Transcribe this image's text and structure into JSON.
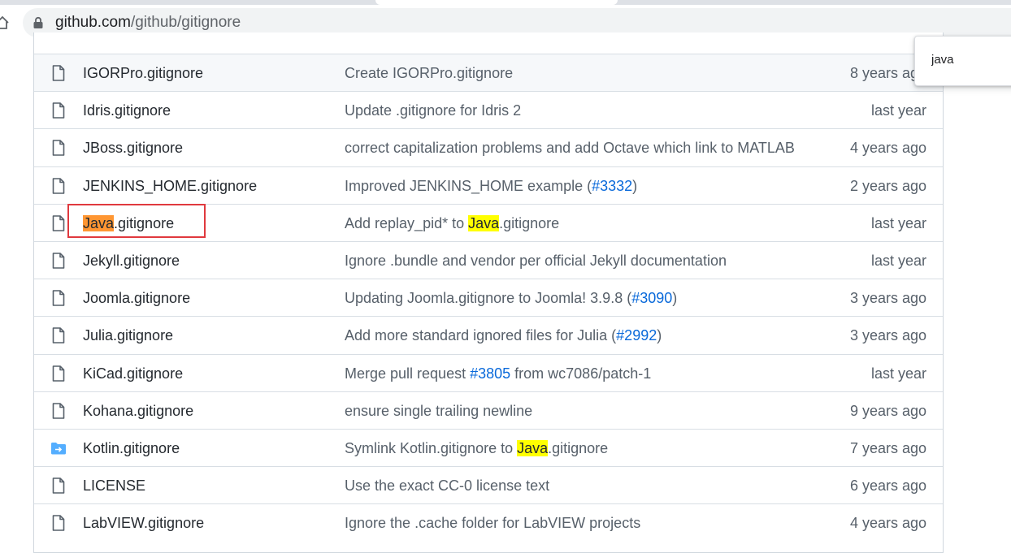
{
  "browser": {
    "url_host": "github.com",
    "url_path": "/github/gitignore"
  },
  "find": {
    "query": "java"
  },
  "files": [
    {
      "icon": "file-icon",
      "name_pre": "",
      "name_hl": "",
      "name_post": "IGORPro.gitignore",
      "msg_pre": "Create IGORPro.gitignore",
      "msg_link": "",
      "msg_hl": "",
      "msg_post": "",
      "age": "8 years ago",
      "hover": true
    },
    {
      "icon": "file-icon",
      "name_pre": "",
      "name_hl": "",
      "name_post": "Idris.gitignore",
      "msg_pre": "Update .gitignore for Idris 2",
      "msg_link": "",
      "msg_hl": "",
      "msg_post": "",
      "age": "last year"
    },
    {
      "icon": "file-icon",
      "name_pre": "",
      "name_hl": "",
      "name_post": "JBoss.gitignore",
      "msg_pre": "correct capitalization problems and add Octave which link to MATLAB",
      "msg_link": "",
      "msg_hl": "",
      "msg_post": "",
      "age": "4 years ago"
    },
    {
      "icon": "file-icon",
      "name_pre": "",
      "name_hl": "",
      "name_post": "JENKINS_HOME.gitignore",
      "msg_pre": "Improved JENKINS_HOME example (",
      "msg_link": "#3332",
      "msg_hl": "",
      "msg_post": ")",
      "age": "2 years ago"
    },
    {
      "icon": "file-icon",
      "name_pre": "",
      "name_hl": "Java",
      "name_hl_active": true,
      "name_post": ".gitignore",
      "msg_pre": "Add replay_pid* to ",
      "msg_link": "",
      "msg_hl": "Java",
      "msg_post": ".gitignore",
      "age": "last year"
    },
    {
      "icon": "file-icon",
      "name_pre": "",
      "name_hl": "",
      "name_post": "Jekyll.gitignore",
      "msg_pre": "Ignore .bundle and vendor per official Jekyll documentation",
      "msg_link": "",
      "msg_hl": "",
      "msg_post": "",
      "age": "last year"
    },
    {
      "icon": "file-icon",
      "name_pre": "",
      "name_hl": "",
      "name_post": "Joomla.gitignore",
      "msg_pre": "Updating Joomla.gitignore to Joomla! 3.9.8 (",
      "msg_link": "#3090",
      "msg_hl": "",
      "msg_post": ")",
      "age": "3 years ago"
    },
    {
      "icon": "file-icon",
      "name_pre": "",
      "name_hl": "",
      "name_post": "Julia.gitignore",
      "msg_pre": "Add more standard ignored files for Julia (",
      "msg_link": "#2992",
      "msg_hl": "",
      "msg_post": ")",
      "age": "3 years ago"
    },
    {
      "icon": "file-icon",
      "name_pre": "",
      "name_hl": "",
      "name_post": "KiCad.gitignore",
      "msg_pre": "Merge pull request ",
      "msg_link": "#3805",
      "msg_hl": "",
      "msg_post": " from wc7086/patch-1",
      "age": "last year"
    },
    {
      "icon": "file-icon",
      "name_pre": "",
      "name_hl": "",
      "name_post": "Kohana.gitignore",
      "msg_pre": "ensure single trailing newline",
      "msg_link": "",
      "msg_hl": "",
      "msg_post": "",
      "age": "9 years ago"
    },
    {
      "icon": "symlink-icon",
      "name_pre": "",
      "name_hl": "",
      "name_post": "Kotlin.gitignore",
      "msg_pre": "Symlink Kotlin.gitignore to ",
      "msg_link": "",
      "msg_hl": "Java",
      "msg_post": ".gitignore",
      "age": "7 years ago"
    },
    {
      "icon": "file-icon",
      "name_pre": "",
      "name_hl": "",
      "name_post": "LICENSE",
      "msg_pre": "Use the exact CC-0 license text",
      "msg_link": "",
      "msg_hl": "",
      "msg_post": "",
      "age": "6 years ago"
    },
    {
      "icon": "file-icon",
      "name_pre": "",
      "name_hl": "",
      "name_post": "LabVIEW.gitignore",
      "msg_pre": "Ignore the .cache folder for LabVIEW projects",
      "msg_link": "",
      "msg_hl": "",
      "msg_post": "",
      "age": "4 years ago"
    }
  ],
  "colors": {
    "link": "#0969da",
    "find_highlight": "#ffff00",
    "find_active_highlight": "#ff9632",
    "annotation_box": "#e0393e",
    "symlink_icon": "#54aeff"
  }
}
